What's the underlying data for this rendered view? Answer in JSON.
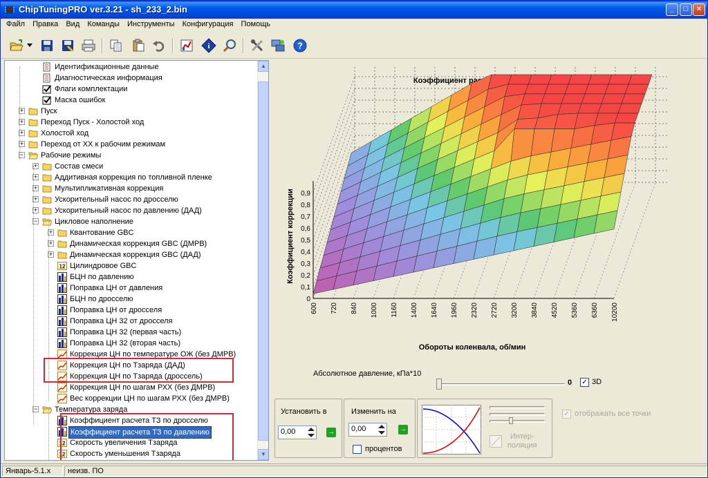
{
  "window": {
    "title": "ChipTuningPRO ver.3.21 - sh_233_2.bin",
    "btn_min": "_",
    "btn_max": "□",
    "btn_close": "×"
  },
  "menu": [
    "Файл",
    "Правка",
    "Вид",
    "Команды",
    "Инструменты",
    "Конфигурация",
    "Помощь"
  ],
  "toolbar": {
    "icons": [
      "open-icon",
      "dropdown-arrow-icon",
      "save-icon",
      "save-as-icon",
      "print-icon",
      "copy-icon",
      "paste-icon",
      "undo-icon",
      "chart-icon",
      "info-icon",
      "search-icon",
      "tools-icon",
      "network-icon",
      "help-icon"
    ]
  },
  "tree": {
    "items": [
      {
        "label": "Идентификационные данные",
        "icon": "doc-icon",
        "level": 2
      },
      {
        "label": "Диагностическая информация",
        "icon": "doc-icon",
        "level": 2
      },
      {
        "label": "Флаги комплектации",
        "icon": "checkbox-icon",
        "level": 2
      },
      {
        "label": "Маска ошибок",
        "icon": "checkbox-icon",
        "level": 2
      },
      {
        "label": "Пуск",
        "icon": "folder-icon",
        "level": 1,
        "expander": "+"
      },
      {
        "label": "Переход Пуск - Холостой ход",
        "icon": "folder-icon",
        "level": 1,
        "expander": "+"
      },
      {
        "label": "Холостой ход",
        "icon": "folder-icon",
        "level": 1,
        "expander": "+"
      },
      {
        "label": "Переход от ХХ к рабочим режимам",
        "icon": "folder-icon",
        "level": 1,
        "expander": "+"
      },
      {
        "label": "Рабочие режимы",
        "icon": "folder-open-icon",
        "level": 1,
        "expander": "−"
      },
      {
        "label": "Состав смеси",
        "icon": "folder-icon",
        "level": 2,
        "expander": "+"
      },
      {
        "label": "Аддитивная коррекция по топливной пленке",
        "icon": "folder-icon",
        "level": 2,
        "expander": "+"
      },
      {
        "label": "Мультипликативная коррекция",
        "icon": "folder-icon",
        "level": 2,
        "expander": "+"
      },
      {
        "label": "Ускорительный насос по дросселю",
        "icon": "folder-icon",
        "level": 2,
        "expander": "+"
      },
      {
        "label": "Ускорительный насос по давлению (ДАД)",
        "icon": "folder-icon",
        "level": 2,
        "expander": "+"
      },
      {
        "label": "Цикловое наполнение",
        "icon": "folder-open-icon",
        "level": 2,
        "expander": "−"
      },
      {
        "label": "Квантование GBC",
        "icon": "folder-icon",
        "level": 3,
        "expander": "+"
      },
      {
        "label": "Динамическая коррекция GBC (ДМРВ)",
        "icon": "folder-icon",
        "level": 3,
        "expander": "+"
      },
      {
        "label": "Динамическая коррекция GBC (ДАД)",
        "icon": "folder-icon",
        "level": 3,
        "expander": "+"
      },
      {
        "label": "Цилиндровое GBC",
        "icon": "number-icon",
        "level": 3
      },
      {
        "label": "БЦН по давлению",
        "icon": "bar-chart-icon",
        "level": 3
      },
      {
        "label": "Поправка ЦН от давления",
        "icon": "bar-chart-icon",
        "level": 3
      },
      {
        "label": "БЦН по дросселю",
        "icon": "bar-chart-icon",
        "level": 3
      },
      {
        "label": "Поправка ЦН от дросселя",
        "icon": "bar-chart-icon",
        "level": 3
      },
      {
        "label": "Поправка ЦН 32 от дросселя",
        "icon": "bar-chart-icon",
        "level": 3
      },
      {
        "label": "Поправка ЦН 32 (первая часть)",
        "icon": "bar-chart-icon",
        "level": 3
      },
      {
        "label": "Поправка ЦН 32 (вторая часть)",
        "icon": "bar-chart-icon",
        "level": 3
      },
      {
        "label": "Коррекция ЦН по температуре ОЖ (без ДМРВ)",
        "icon": "line-chart-icon",
        "level": 3
      },
      {
        "label": "Коррекция ЦН по Тзаряда (ДАД)",
        "icon": "line-chart-icon",
        "level": 3
      },
      {
        "label": "Коррекция ЦН по Тзаряда (дроссель)",
        "icon": "line-chart-icon",
        "level": 3
      },
      {
        "label": "Коррекция ЦН по шагам РХХ (без ДМРВ)",
        "icon": "line-chart-icon",
        "level": 3
      },
      {
        "label": "Вес коррекции ЦН по шагам РХХ (без ДМРВ)",
        "icon": "line-chart-icon",
        "level": 3
      },
      {
        "label": "Температура заряда",
        "icon": "folder-open-icon",
        "level": 2,
        "expander": "−"
      },
      {
        "label": "Коэффициент расчета ТЗ по дросселю",
        "icon": "bar-chart-icon",
        "level": 3
      },
      {
        "label": "Коэффициент расчета ТЗ по давлению",
        "icon": "bar-chart-icon",
        "level": 3,
        "selected": true
      },
      {
        "label": "Скорость увеличения Тзаряда",
        "icon": "number-icon",
        "level": 3
      },
      {
        "label": "Скорость уменьшения Тзаряда",
        "icon": "number-icon",
        "level": 3
      }
    ]
  },
  "chart_data": {
    "type": "surface3d",
    "title": "Коэффициент расчета ТЗ по давлению",
    "xlabel": "Обороты коленвала, об/мин",
    "ylabel": "Коэффициент коррекции",
    "zlabel": "Абсолютное давление, кПа*10",
    "x_ticks": [
      "600",
      "720",
      "840",
      "1000",
      "1160",
      "1400",
      "1640",
      "1960",
      "2320",
      "2720",
      "3200",
      "3840",
      "4520",
      "5360",
      "6360",
      "10200"
    ],
    "y_ticks": [
      "0",
      "0,1",
      "0,2",
      "0,3",
      "0,4",
      "0,5",
      "0,6",
      "0,7",
      "0,8",
      "0,9"
    ],
    "ylim": [
      0,
      1
    ],
    "slider_value": "0",
    "checkbox_3d_label": "3D",
    "checkbox_3d_checked": true
  },
  "bottom": {
    "set_label": "Установить в",
    "set_value": "0,00",
    "change_label": "Изменить на",
    "change_value": "0,00",
    "percent_label": "процентов",
    "interp_label": "Интер-\nполяция",
    "show_all_label": "отображать все точки"
  },
  "status": {
    "left": "Январь-5.1.x",
    "right": "неизв. ПО"
  }
}
